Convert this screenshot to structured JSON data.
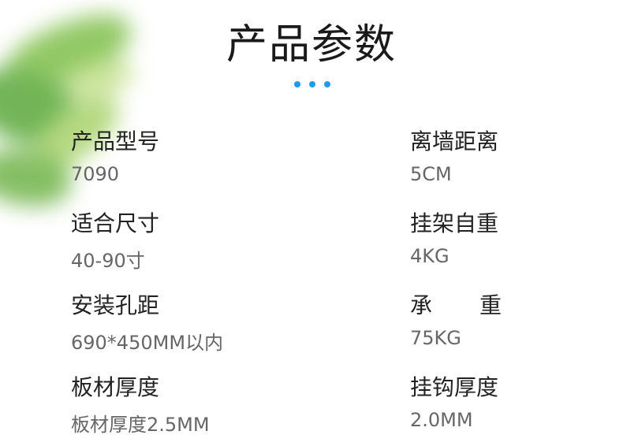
{
  "title": "产品参数",
  "accent_color": "#1e9be9",
  "left": [
    {
      "label": "产品型号",
      "value": "7090"
    },
    {
      "label": "适合尺寸",
      "value": "40-90寸"
    },
    {
      "label": "安装孔距",
      "value": "690*450MM以内"
    },
    {
      "label": "板材厚度",
      "value": "板材厚度2.5MM"
    }
  ],
  "right": [
    {
      "label": "离墙距离",
      "value": "5CM"
    },
    {
      "label": "挂架自重",
      "value": "4KG"
    },
    {
      "label": "承重",
      "label_chars": [
        "承",
        "重"
      ],
      "value": "75KG"
    },
    {
      "label": "挂钩厚度",
      "value": "2.0MM"
    }
  ]
}
